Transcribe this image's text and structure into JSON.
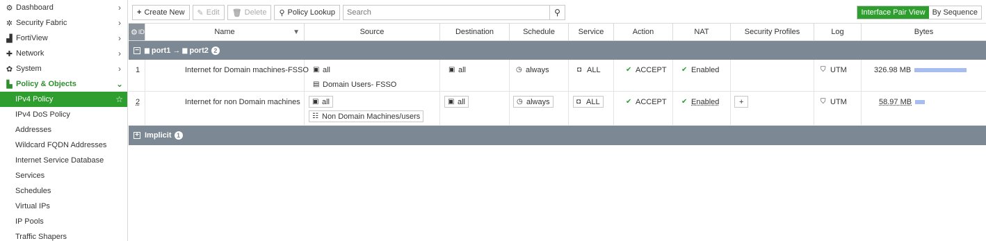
{
  "sidebar": {
    "items": [
      {
        "icon": "dashboard-icon",
        "glyph": "⚙",
        "label": "Dashboard"
      },
      {
        "icon": "security-fabric-icon",
        "glyph": "✲",
        "label": "Security Fabric"
      },
      {
        "icon": "fortiview-icon",
        "glyph": "▟",
        "label": "FortiView"
      },
      {
        "icon": "network-icon",
        "glyph": "✚",
        "label": "Network"
      },
      {
        "icon": "system-icon",
        "glyph": "✿",
        "label": "System"
      },
      {
        "icon": "policy-objects-icon",
        "glyph": "▙",
        "label": "Policy & Objects"
      }
    ],
    "sub_items": [
      "IPv4 Policy",
      "IPv4 DoS Policy",
      "Addresses",
      "Wildcard FQDN Addresses",
      "Internet Service Database",
      "Services",
      "Schedules",
      "Virtual IPs",
      "IP Pools",
      "Traffic Shapers"
    ]
  },
  "toolbar": {
    "create_new": "Create New",
    "edit": "Edit",
    "delete": "Delete",
    "policy_lookup": "Policy Lookup",
    "search_placeholder": "Search"
  },
  "view_toggle": {
    "interface_pair": "Interface Pair View",
    "by_sequence": "By Sequence"
  },
  "table": {
    "columns": [
      "ID",
      "Name",
      "Source",
      "Destination",
      "Schedule",
      "Service",
      "Action",
      "NAT",
      "Security Profiles",
      "Log",
      "Bytes"
    ],
    "group1": {
      "from": "port1",
      "arrow": "→",
      "to": "port2",
      "count": "2"
    },
    "rows": [
      {
        "id": "1",
        "name": "Internet for Domain machines-FSSO",
        "source": [
          "all",
          "Domain Users- FSSO"
        ],
        "destination": "all",
        "schedule": "always",
        "service": "ALL",
        "action": "ACCEPT",
        "nat": "Enabled",
        "security_profiles": "",
        "log": "UTM",
        "bytes": "326.98 MB",
        "bytes_fraction": 1.0
      },
      {
        "id": "2",
        "name": "Internet for non Domain machines",
        "source": [
          "all",
          "Non Domain Machines/users"
        ],
        "destination": "all",
        "schedule": "always",
        "service": "ALL",
        "action": "ACCEPT",
        "nat": "Enabled",
        "security_profiles": "+",
        "log": "UTM",
        "bytes": "58.97 MB",
        "bytes_fraction": 0.18
      }
    ],
    "group2": {
      "label": "Implicit",
      "count": "1"
    }
  },
  "colors": {
    "accent": "#2e9e2e",
    "group_row": "#7c8893",
    "bytes_bar": "#a7bdf0"
  }
}
